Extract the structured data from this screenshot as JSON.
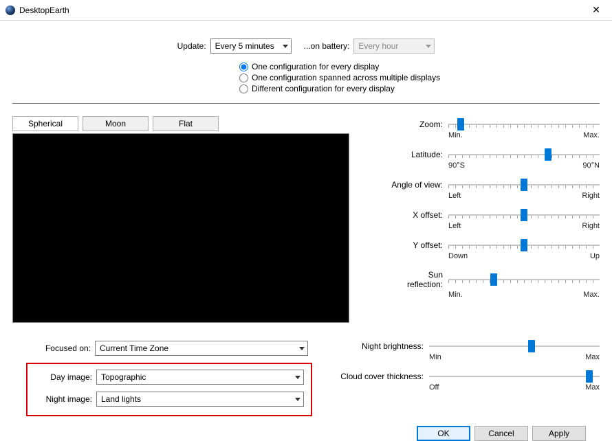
{
  "window": {
    "title": "DesktopEarth"
  },
  "update": {
    "label": "Update:",
    "value": "Every 5 minutes",
    "battery_label": "...on battery:",
    "battery_value": "Every hour"
  },
  "config_radios": {
    "opt1": "One configuration for every display",
    "opt2": "One configuration spanned across multiple displays",
    "opt3": "Different configuration for every display"
  },
  "tabs": {
    "spherical": "Spherical",
    "moon": "Moon",
    "flat": "Flat"
  },
  "sliders": {
    "zoom": {
      "label": "Zoom:",
      "min": "Min.",
      "max": "Max.",
      "pos": 8
    },
    "lat": {
      "label": "Latitude:",
      "min": "90°S",
      "max": "90°N",
      "pos": 66
    },
    "angle": {
      "label": "Angle of view:",
      "min": "Left",
      "max": "Right",
      "pos": 50
    },
    "xoff": {
      "label": "X offset:",
      "min": "Left",
      "max": "Right",
      "pos": 50
    },
    "yoff": {
      "label": "Y offset:",
      "min": "Down",
      "max": "Up",
      "pos": 50
    },
    "sunref": {
      "label": "Sun reflection:",
      "min": "Min.",
      "max": "Max.",
      "pos": 30
    }
  },
  "focus": {
    "label": "Focused on:",
    "value": "Current Time Zone"
  },
  "dayimg": {
    "label": "Day image:",
    "value": "Topographic"
  },
  "nightimg": {
    "label": "Night image:",
    "value": "Land lights"
  },
  "sliders2": {
    "nightbr": {
      "label": "Night brightness:",
      "min": "Min",
      "max": "Max",
      "pos": 60
    },
    "cloud": {
      "label": "Cloud cover thickness:",
      "min": "Off",
      "max": "Max",
      "pos": 94
    }
  },
  "buttons": {
    "ok": "OK",
    "cancel": "Cancel",
    "apply": "Apply"
  }
}
